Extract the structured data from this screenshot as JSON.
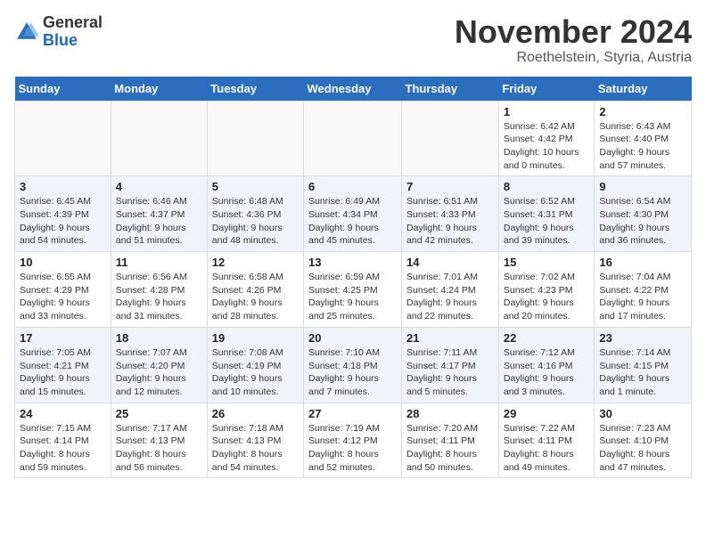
{
  "header": {
    "logo_general": "General",
    "logo_blue": "Blue",
    "month_title": "November 2024",
    "location": "Roethelstein, Styria, Austria"
  },
  "weekdays": [
    "Sunday",
    "Monday",
    "Tuesday",
    "Wednesday",
    "Thursday",
    "Friday",
    "Saturday"
  ],
  "weeks": [
    [
      {
        "day": "",
        "info": ""
      },
      {
        "day": "",
        "info": ""
      },
      {
        "day": "",
        "info": ""
      },
      {
        "day": "",
        "info": ""
      },
      {
        "day": "",
        "info": ""
      },
      {
        "day": "1",
        "info": "Sunrise: 6:42 AM\nSunset: 4:42 PM\nDaylight: 10 hours\nand 0 minutes."
      },
      {
        "day": "2",
        "info": "Sunrise: 6:43 AM\nSunset: 4:40 PM\nDaylight: 9 hours\nand 57 minutes."
      }
    ],
    [
      {
        "day": "3",
        "info": "Sunrise: 6:45 AM\nSunset: 4:39 PM\nDaylight: 9 hours\nand 54 minutes."
      },
      {
        "day": "4",
        "info": "Sunrise: 6:46 AM\nSunset: 4:37 PM\nDaylight: 9 hours\nand 51 minutes."
      },
      {
        "day": "5",
        "info": "Sunrise: 6:48 AM\nSunset: 4:36 PM\nDaylight: 9 hours\nand 48 minutes."
      },
      {
        "day": "6",
        "info": "Sunrise: 6:49 AM\nSunset: 4:34 PM\nDaylight: 9 hours\nand 45 minutes."
      },
      {
        "day": "7",
        "info": "Sunrise: 6:51 AM\nSunset: 4:33 PM\nDaylight: 9 hours\nand 42 minutes."
      },
      {
        "day": "8",
        "info": "Sunrise: 6:52 AM\nSunset: 4:31 PM\nDaylight: 9 hours\nand 39 minutes."
      },
      {
        "day": "9",
        "info": "Sunrise: 6:54 AM\nSunset: 4:30 PM\nDaylight: 9 hours\nand 36 minutes."
      }
    ],
    [
      {
        "day": "10",
        "info": "Sunrise: 6:55 AM\nSunset: 4:29 PM\nDaylight: 9 hours\nand 33 minutes."
      },
      {
        "day": "11",
        "info": "Sunrise: 6:56 AM\nSunset: 4:28 PM\nDaylight: 9 hours\nand 31 minutes."
      },
      {
        "day": "12",
        "info": "Sunrise: 6:58 AM\nSunset: 4:26 PM\nDaylight: 9 hours\nand 28 minutes."
      },
      {
        "day": "13",
        "info": "Sunrise: 6:59 AM\nSunset: 4:25 PM\nDaylight: 9 hours\nand 25 minutes."
      },
      {
        "day": "14",
        "info": "Sunrise: 7:01 AM\nSunset: 4:24 PM\nDaylight: 9 hours\nand 22 minutes."
      },
      {
        "day": "15",
        "info": "Sunrise: 7:02 AM\nSunset: 4:23 PM\nDaylight: 9 hours\nand 20 minutes."
      },
      {
        "day": "16",
        "info": "Sunrise: 7:04 AM\nSunset: 4:22 PM\nDaylight: 9 hours\nand 17 minutes."
      }
    ],
    [
      {
        "day": "17",
        "info": "Sunrise: 7:05 AM\nSunset: 4:21 PM\nDaylight: 9 hours\nand 15 minutes."
      },
      {
        "day": "18",
        "info": "Sunrise: 7:07 AM\nSunset: 4:20 PM\nDaylight: 9 hours\nand 12 minutes."
      },
      {
        "day": "19",
        "info": "Sunrise: 7:08 AM\nSunset: 4:19 PM\nDaylight: 9 hours\nand 10 minutes."
      },
      {
        "day": "20",
        "info": "Sunrise: 7:10 AM\nSunset: 4:18 PM\nDaylight: 9 hours\nand 7 minutes."
      },
      {
        "day": "21",
        "info": "Sunrise: 7:11 AM\nSunset: 4:17 PM\nDaylight: 9 hours\nand 5 minutes."
      },
      {
        "day": "22",
        "info": "Sunrise: 7:12 AM\nSunset: 4:16 PM\nDaylight: 9 hours\nand 3 minutes."
      },
      {
        "day": "23",
        "info": "Sunrise: 7:14 AM\nSunset: 4:15 PM\nDaylight: 9 hours\nand 1 minute."
      }
    ],
    [
      {
        "day": "24",
        "info": "Sunrise: 7:15 AM\nSunset: 4:14 PM\nDaylight: 8 hours\nand 59 minutes."
      },
      {
        "day": "25",
        "info": "Sunrise: 7:17 AM\nSunset: 4:13 PM\nDaylight: 8 hours\nand 56 minutes."
      },
      {
        "day": "26",
        "info": "Sunrise: 7:18 AM\nSunset: 4:13 PM\nDaylight: 8 hours\nand 54 minutes."
      },
      {
        "day": "27",
        "info": "Sunrise: 7:19 AM\nSunset: 4:12 PM\nDaylight: 8 hours\nand 52 minutes."
      },
      {
        "day": "28",
        "info": "Sunrise: 7:20 AM\nSunset: 4:11 PM\nDaylight: 8 hours\nand 50 minutes."
      },
      {
        "day": "29",
        "info": "Sunrise: 7:22 AM\nSunset: 4:11 PM\nDaylight: 8 hours\nand 49 minutes."
      },
      {
        "day": "30",
        "info": "Sunrise: 7:23 AM\nSunset: 4:10 PM\nDaylight: 8 hours\nand 47 minutes."
      }
    ]
  ]
}
